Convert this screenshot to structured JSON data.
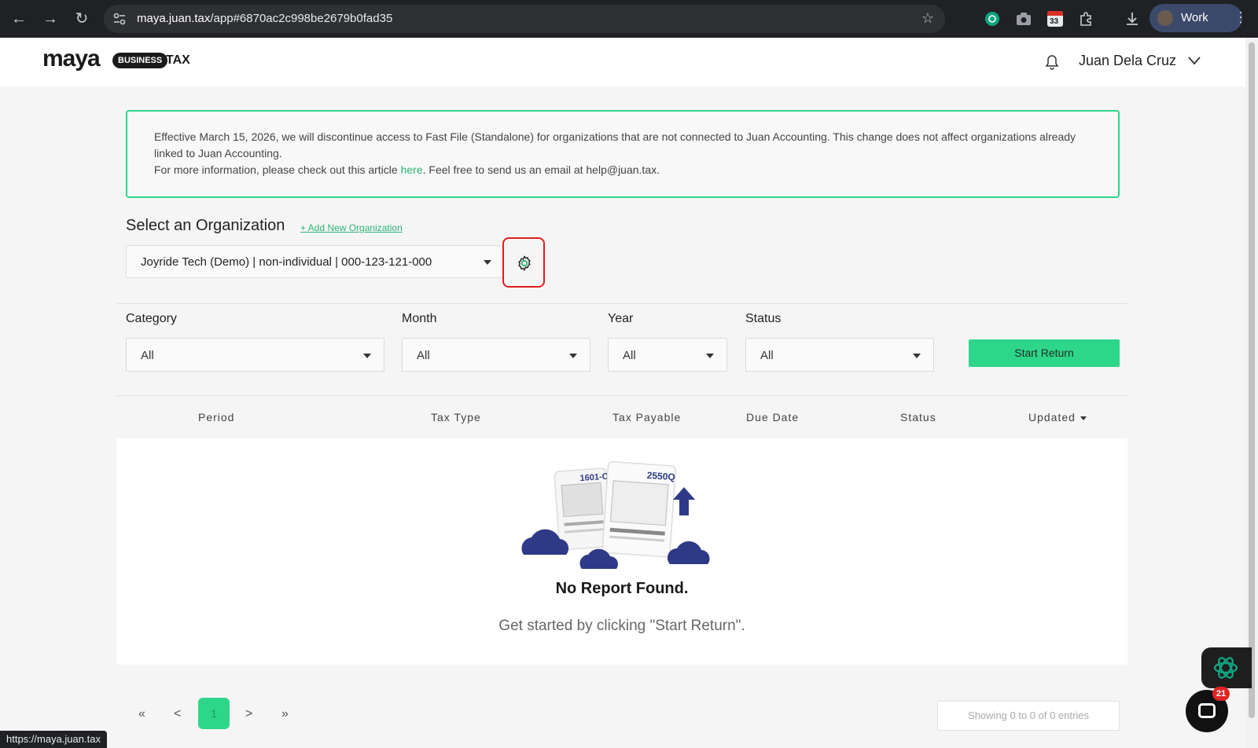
{
  "browser": {
    "url_host": "maya.juan.tax",
    "url_path": "/app#6870ac2c998be2679b0fad35",
    "profile_label": "Work",
    "calendar_badge": "33",
    "status_url": "https://maya.juan.tax"
  },
  "header": {
    "logo_text": "maya",
    "logo_badge": "BUSINESS",
    "logo_suffix": "TAX",
    "user_name": "Juan Dela Cruz"
  },
  "notice": {
    "line1": "Effective March 15, 2026, we will discontinue access to Fast File (Standalone) for organizations that are not connected to Juan Accounting. This change does not affect organizations already linked to Juan Accounting.",
    "line2_before": "For more information, please check out this article ",
    "link_label": "here",
    "line2_after": ". Feel free to send us an email at help@juan.tax."
  },
  "org": {
    "title": "Select an Organization",
    "add_label": "+ Add New Organization",
    "selected": "Joyride Tech (Demo) | non-individual | 000-123-121-000"
  },
  "filters": {
    "category_label": "Category",
    "category_value": "All",
    "month_label": "Month",
    "month_value": "All",
    "year_label": "Year",
    "year_value": "All",
    "status_label": "Status",
    "status_value": "All",
    "start_return": "Start Return"
  },
  "table": {
    "columns": [
      "Period",
      "Tax Type",
      "Tax Payable",
      "Due Date",
      "Status",
      "Updated"
    ]
  },
  "empty": {
    "form_a": "1601-C",
    "form_b": "2550Q",
    "title": "No Report Found.",
    "subtitle": "Get started by clicking \"Start Return\"."
  },
  "pagination": {
    "first": "«",
    "prev": "<",
    "current": "1",
    "next": ">",
    "last": "»",
    "entries": "Showing 0 to 0 of 0 entries"
  },
  "widgets": {
    "chat_badge": "21"
  },
  "colors": {
    "accent": "#2ed68a",
    "link": "#2bb673",
    "highlight": "#e01e1e",
    "illustration": "#2e3a87"
  }
}
